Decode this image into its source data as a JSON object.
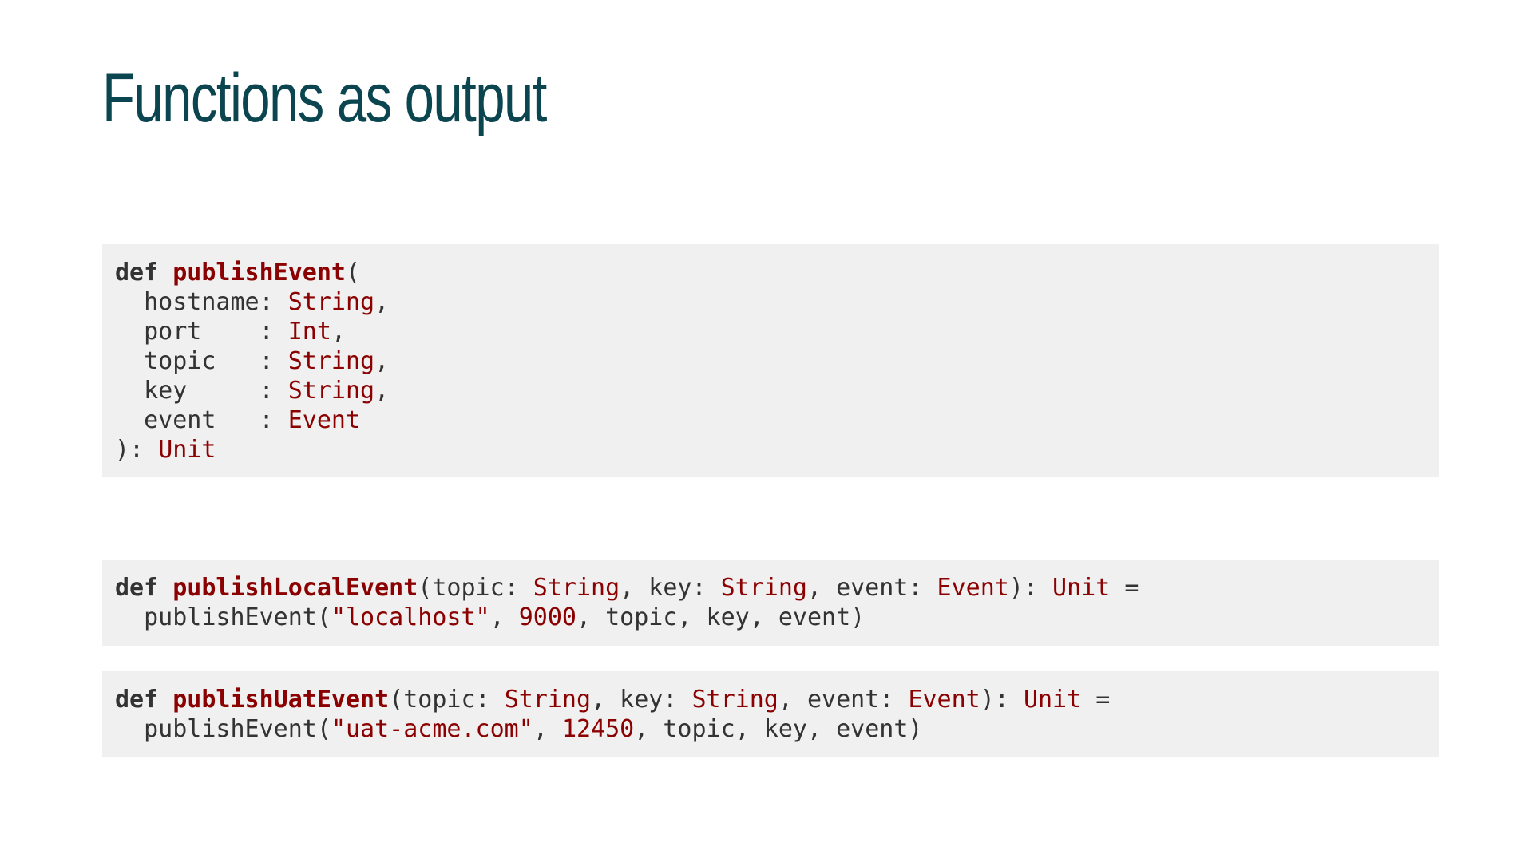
{
  "title": "Functions as output",
  "code_blocks": [
    {
      "lines": [
        [
          {
            "t": "kw",
            "v": "def"
          },
          {
            "t": "pl",
            "v": " "
          },
          {
            "t": "fn",
            "v": "publishEvent"
          },
          {
            "t": "pl",
            "v": "("
          }
        ],
        [
          {
            "t": "pl",
            "v": "  hostname: "
          },
          {
            "t": "ty",
            "v": "String"
          },
          {
            "t": "pl",
            "v": ","
          }
        ],
        [
          {
            "t": "pl",
            "v": "  port    : "
          },
          {
            "t": "ty",
            "v": "Int"
          },
          {
            "t": "pl",
            "v": ","
          }
        ],
        [
          {
            "t": "pl",
            "v": "  topic   : "
          },
          {
            "t": "ty",
            "v": "String"
          },
          {
            "t": "pl",
            "v": ","
          }
        ],
        [
          {
            "t": "pl",
            "v": "  key     : "
          },
          {
            "t": "ty",
            "v": "String"
          },
          {
            "t": "pl",
            "v": ","
          }
        ],
        [
          {
            "t": "pl",
            "v": "  event   : "
          },
          {
            "t": "ty",
            "v": "Event"
          }
        ],
        [
          {
            "t": "pl",
            "v": "): "
          },
          {
            "t": "ty",
            "v": "Unit"
          }
        ]
      ]
    },
    {
      "lines": [
        [
          {
            "t": "kw",
            "v": "def"
          },
          {
            "t": "pl",
            "v": " "
          },
          {
            "t": "fn",
            "v": "publishLocalEvent"
          },
          {
            "t": "pl",
            "v": "(topic: "
          },
          {
            "t": "ty",
            "v": "String"
          },
          {
            "t": "pl",
            "v": ", key: "
          },
          {
            "t": "ty",
            "v": "String"
          },
          {
            "t": "pl",
            "v": ", event: "
          },
          {
            "t": "ty",
            "v": "Event"
          },
          {
            "t": "pl",
            "v": "): "
          },
          {
            "t": "ty",
            "v": "Unit"
          },
          {
            "t": "pl",
            "v": " ="
          }
        ],
        [
          {
            "t": "pl",
            "v": "  publishEvent("
          },
          {
            "t": "st",
            "v": "\"localhost\""
          },
          {
            "t": "pl",
            "v": ", "
          },
          {
            "t": "nu",
            "v": "9000"
          },
          {
            "t": "pl",
            "v": ", topic, key, event)"
          }
        ]
      ]
    },
    {
      "lines": [
        [
          {
            "t": "kw",
            "v": "def"
          },
          {
            "t": "pl",
            "v": " "
          },
          {
            "t": "fn",
            "v": "publishUatEvent"
          },
          {
            "t": "pl",
            "v": "(topic: "
          },
          {
            "t": "ty",
            "v": "String"
          },
          {
            "t": "pl",
            "v": ", key: "
          },
          {
            "t": "ty",
            "v": "String"
          },
          {
            "t": "pl",
            "v": ", event: "
          },
          {
            "t": "ty",
            "v": "Event"
          },
          {
            "t": "pl",
            "v": "): "
          },
          {
            "t": "ty",
            "v": "Unit"
          },
          {
            "t": "pl",
            "v": " ="
          }
        ],
        [
          {
            "t": "pl",
            "v": "  publishEvent("
          },
          {
            "t": "st",
            "v": "\"uat-acme.com\""
          },
          {
            "t": "pl",
            "v": ", "
          },
          {
            "t": "nu",
            "v": "12450"
          },
          {
            "t": "pl",
            "v": ", topic, key, event)"
          }
        ]
      ]
    }
  ]
}
